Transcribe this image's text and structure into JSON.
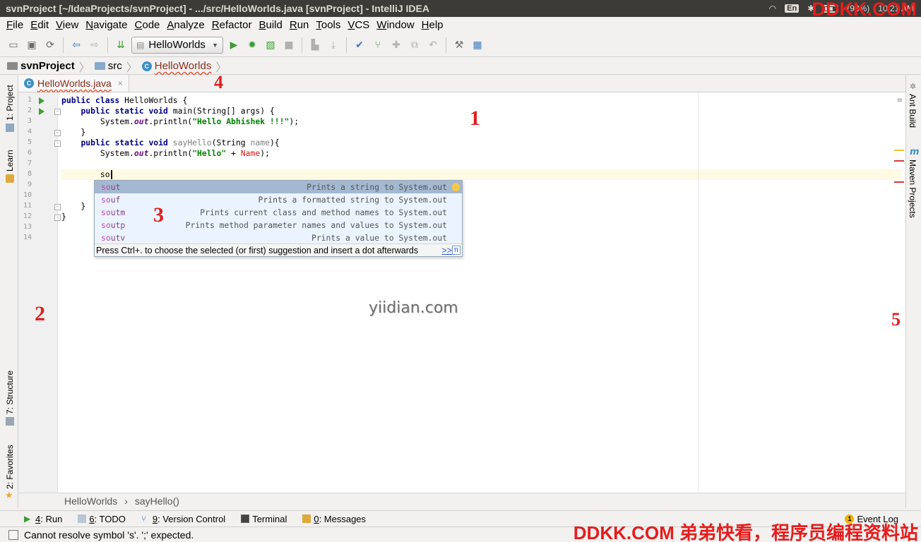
{
  "window": {
    "title": "svnProject [~/IdeaProjects/svnProject] - .../src/HelloWorlds.java [svnProject] - IntelliJ IDEA",
    "tray_lang": "En",
    "tray_battery": "(93%)",
    "tray_time": "10:21 AM"
  },
  "menu": [
    "File",
    "Edit",
    "View",
    "Navigate",
    "Code",
    "Analyze",
    "Refactor",
    "Build",
    "Run",
    "Tools",
    "VCS",
    "Window",
    "Help"
  ],
  "toolbar": {
    "run_config": "HelloWorlds"
  },
  "breadcrumb": [
    "svnProject",
    "src",
    "HelloWorlds"
  ],
  "tabs": [
    {
      "label": "HelloWorlds.java",
      "close": "×"
    }
  ],
  "left_tools": [
    "1: Project",
    "Learn",
    "7: Structure",
    "2: Favorites"
  ],
  "right_tools": [
    "Ant Build",
    "Maven Projects"
  ],
  "editor": {
    "line_numbers": [
      "1",
      "2",
      "3",
      "4",
      "5",
      "6",
      "7",
      "8",
      "9",
      "10",
      "11",
      "12",
      "13",
      "14"
    ],
    "lines": {
      "l1_kw": "public class ",
      "l1_rest": "HelloWorlds {",
      "l2_indent": "    ",
      "l2_kw": "public static void ",
      "l2_rest": "main(String[] args) {",
      "l3_pre": "        System.",
      "l3_field": "out",
      "l3_mid": ".println(",
      "l3_str": "\"Hello Abhishek !!!\"",
      "l3_end": ");",
      "l4": "    }",
      "l5_indent": "    ",
      "l5_kw": "public static void ",
      "l5_meth": "sayHello",
      "l5_mid": "(String ",
      "l5_param": "name",
      "l5_end": "){",
      "l6_pre": "        System.",
      "l6_field": "out",
      "l6_mid": ".println(",
      "l6_str": "\"Hello\"",
      "l6_plus": " + ",
      "l6_err": "Name",
      "l6_end": ");",
      "l8_pre": "        ",
      "l8_typed": "so",
      "l11": "    }",
      "l12": "}"
    }
  },
  "completion": {
    "items": [
      {
        "prefix": "so",
        "rest": "ut",
        "desc": "Prints a string to System.out"
      },
      {
        "prefix": "so",
        "rest": "uf",
        "desc": "Prints a formatted string to System.out"
      },
      {
        "prefix": "so",
        "rest": "utm",
        "desc": "Prints current class and method names to System.out"
      },
      {
        "prefix": "so",
        "rest": "utp",
        "desc": "Prints method parameter names and values to System.out"
      },
      {
        "prefix": "so",
        "rest": "utv",
        "desc": "Prints a value to System.out"
      }
    ],
    "footer": "Press Ctrl+. to choose the selected (or first) suggestion and insert a dot afterwards",
    "more": ">>",
    "pi": "π"
  },
  "editor_crumbs": [
    "HelloWorlds",
    "sayHello()"
  ],
  "tool_windows": [
    {
      "num": "4",
      "label": ": Run"
    },
    {
      "num": "6",
      "label": ": TODO"
    },
    {
      "num": "9",
      "label": ": Version Control"
    },
    {
      "num": "",
      "label": "Terminal"
    },
    {
      "num": "0",
      "label": ": Messages"
    }
  ],
  "event_log": {
    "badge": "1",
    "label": "Event Log"
  },
  "status": "Cannot resolve symbol 's'. ';' expected.",
  "annotations": {
    "m1": "1",
    "m2": "2",
    "m3": "3",
    "m4": "4",
    "m5": "5"
  },
  "watermarks": {
    "top": "DDKK.COM",
    "bottom": "DDKK.COM 弟弟快看，程序员编程资料站",
    "center": "yiidian.com"
  },
  "colors": {
    "accent": "#3d8fc9",
    "run_green": "#3f9c35",
    "marker_red": "#e02020",
    "selection": "#a3b8d1"
  }
}
